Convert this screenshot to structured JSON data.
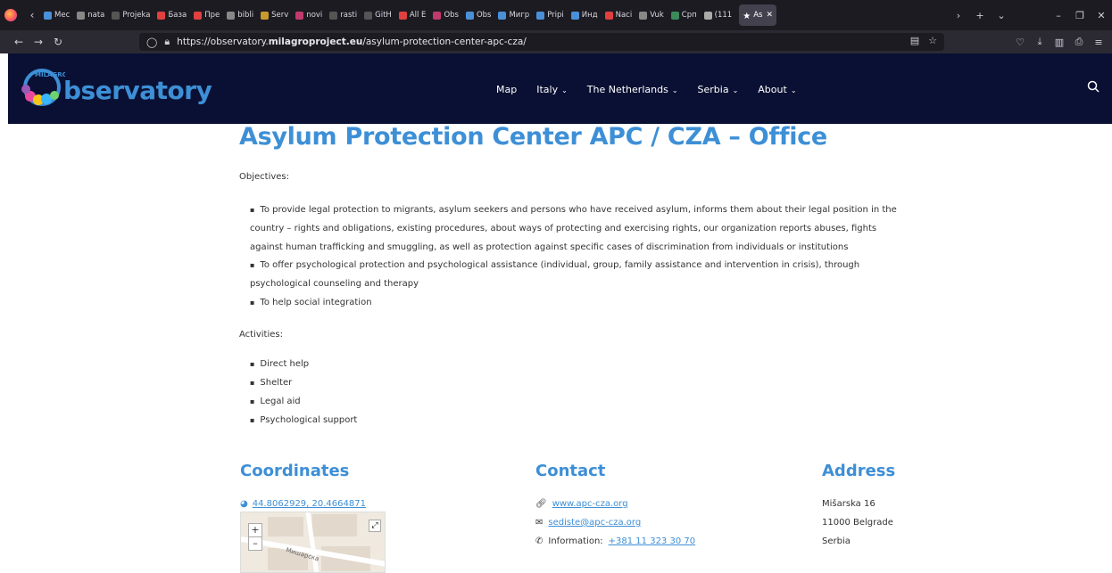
{
  "browser": {
    "tabs": [
      {
        "label": "Mec",
        "color": "#4a90d9"
      },
      {
        "label": "nata",
        "color": "#888"
      },
      {
        "label": "Projeka",
        "color": "#555"
      },
      {
        "label": "База",
        "color": "#e04040"
      },
      {
        "label": "Пре",
        "color": "#e04040"
      },
      {
        "label": "bibli",
        "color": "#888"
      },
      {
        "label": "Serv",
        "color": "#c79a2e"
      },
      {
        "label": "novi",
        "color": "#c03a6b"
      },
      {
        "label": "rasti",
        "color": "#555"
      },
      {
        "label": "GitH",
        "color": "#555"
      },
      {
        "label": "All E",
        "color": "#e04040"
      },
      {
        "label": "Obs",
        "color": "#c03a6b"
      },
      {
        "label": "Obs",
        "color": "#4a90d9"
      },
      {
        "label": "Мигр",
        "color": "#4a90d9"
      },
      {
        "label": "Pripi",
        "color": "#4a90d9"
      },
      {
        "label": "Инд",
        "color": "#4a90d9"
      },
      {
        "label": "Naci",
        "color": "#e04040"
      },
      {
        "label": "Vuk",
        "color": "#888"
      },
      {
        "label": "Срп",
        "color": "#3a8a5a"
      },
      {
        "label": "(111",
        "color": "#aaa"
      }
    ],
    "active_tab": "As",
    "url_prefix": "https://observatory.",
    "url_domain": "milagroproject.eu",
    "url_path": "/asylum-protection-center-apc-cza/"
  },
  "site": {
    "logo_text": "bservatory",
    "logo_letter": "O",
    "menu": [
      {
        "label": "Map",
        "dropdown": false
      },
      {
        "label": "Italy",
        "dropdown": true
      },
      {
        "label": "The Netherlands",
        "dropdown": true
      },
      {
        "label": "Serbia",
        "dropdown": true
      },
      {
        "label": "About",
        "dropdown": true
      }
    ]
  },
  "page": {
    "title": "Asylum Protection Center APC / CZA – Office",
    "objectives_label": "Objectives:",
    "objectives": [
      "To provide legal protection to migrants, asylum seekers and persons who have received asylum, informs them about their legal position in the country – rights and obligations, existing procedures, about ways of protecting and exercising rights, our organization reports abuses, fights against human trafficking and smuggling, as well as protection against specific cases of discrimination from individuals or institutions",
      "To offer psychological protection and psychological assistance (individual, group, family assistance and intervention in crisis), through psychological counseling and therapy",
      "To help social integration"
    ],
    "activities_label": "Activities:",
    "activities": [
      "Direct help",
      "Shelter",
      "Legal aid",
      "Psychological support"
    ],
    "coordinates_heading": "Coordinates",
    "coordinates": "44.8062929, 20.4664871",
    "contact_heading": "Contact",
    "website": "www.apc-cza.org",
    "email": "sediste@apc-cza.org",
    "phone_label": "Information:",
    "phone": "+381 11 323 30 70",
    "address_heading": "Address",
    "address_street": "Mišarska 16",
    "address_city": "11000 Belgrade",
    "address_country": "Serbia",
    "map_street_label": "Мишарска"
  }
}
